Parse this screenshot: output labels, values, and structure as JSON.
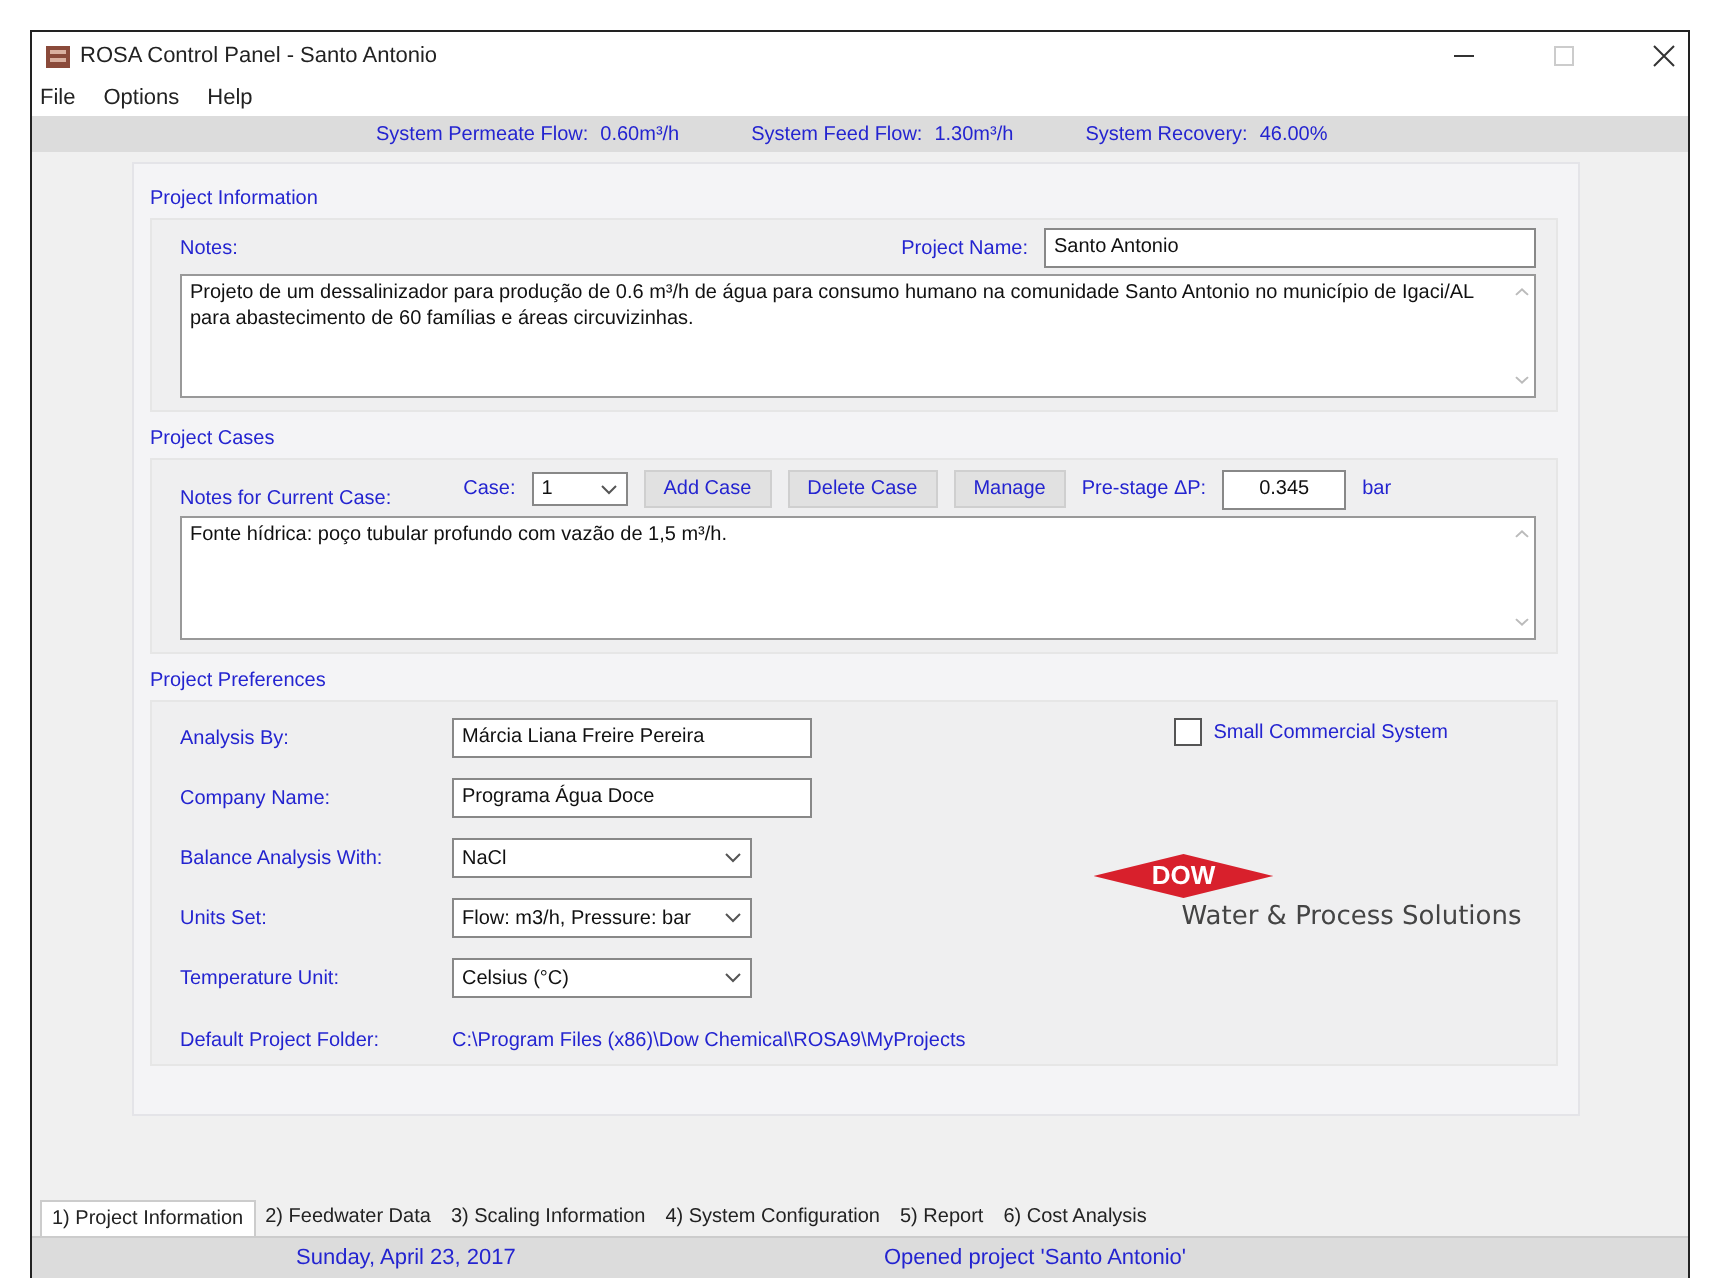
{
  "window": {
    "title": "ROSA Control Panel - Santo Antonio"
  },
  "menu": [
    "File",
    "Options",
    "Help"
  ],
  "summary": [
    {
      "label": "System Permeate Flow:",
      "value": "0.60m³/h"
    },
    {
      "label": "System Feed Flow:",
      "value": "1.30m³/h"
    },
    {
      "label": "System Recovery:",
      "value": "46.00%"
    }
  ],
  "project_information": {
    "title": "Project Information",
    "notes_label": "Notes:",
    "project_name_label": "Project Name:",
    "project_name": "Santo Antonio",
    "notes": "Projeto de um dessalinizador para produção de 0.6 m³/h de água para consumo humano na comunidade Santo Antonio no município de Igaci/AL para abastecimento de 60 famílias e áreas circuvizinhas."
  },
  "project_cases": {
    "title": "Project Cases",
    "notes_label": "Notes for Current Case:",
    "case_label": "Case:",
    "case": "1",
    "buttons": [
      "Add Case",
      "Delete Case",
      "Manage"
    ],
    "prestage_label": "Pre-stage ΔP:",
    "prestage": "0.345",
    "prestage_unit": "bar",
    "notes": "Fonte hídrica: poço tubular profundo com vazão de 1,5 m³/h."
  },
  "project_preferences": {
    "title": "Project Preferences",
    "fields": [
      {
        "kind": "text",
        "label": "Analysis By:",
        "value": "Márcia Liana Freire Pereira"
      },
      {
        "kind": "text",
        "label": "Company Name:",
        "value": "Programa Água Doce"
      },
      {
        "kind": "select",
        "label": "Balance Analysis With:",
        "value": "NaCl"
      },
      {
        "kind": "select",
        "label": "Units Set:",
        "value": "Flow: m3/h, Pressure: bar"
      },
      {
        "kind": "select",
        "label": "Temperature Unit:",
        "value": "Celsius (°C)"
      }
    ],
    "small_commercial": {
      "label": "Small Commercial System",
      "checked": false
    },
    "logo_text": "DOW",
    "logo_tagline": "Water & Process Solutions",
    "folder_label": "Default Project Folder:",
    "folder": "C:\\Program Files (x86)\\Dow Chemical\\ROSA9\\MyProjects"
  },
  "tabs": [
    {
      "label": "1) Project Information",
      "selected": true
    },
    {
      "label": "2) Feedwater Data",
      "selected": false
    },
    {
      "label": "3) Scaling Information",
      "selected": false
    },
    {
      "label": "4) System Configuration",
      "selected": false
    },
    {
      "label": "5) Report",
      "selected": false
    },
    {
      "label": "6) Cost Analysis",
      "selected": false
    }
  ],
  "status_bar": [
    "Sunday, April 23, 2017",
    "Opened project 'Santo Antonio'"
  ]
}
